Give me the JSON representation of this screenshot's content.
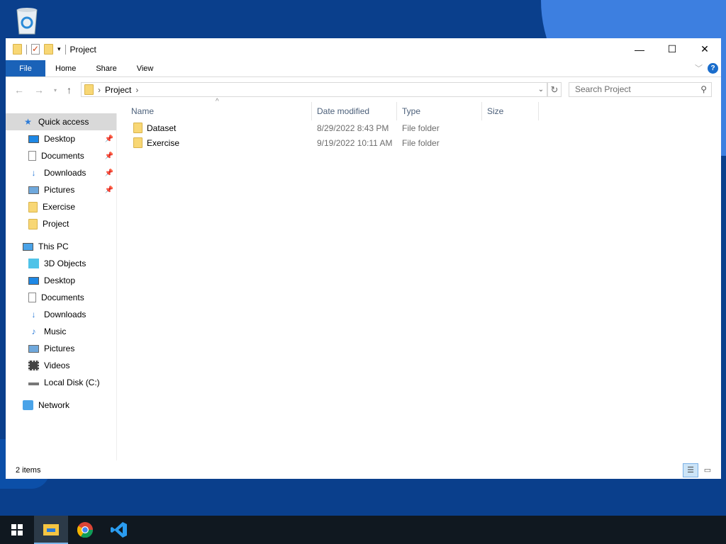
{
  "window": {
    "title": "Project"
  },
  "ribbon": {
    "tabs": [
      "File",
      "Home",
      "Share",
      "View"
    ],
    "help": "?"
  },
  "address": {
    "crumb": "Project",
    "search_placeholder": "Search Project"
  },
  "nav": {
    "quick_access": "Quick access",
    "quick_items": [
      {
        "label": "Desktop",
        "pinned": true
      },
      {
        "label": "Documents",
        "pinned": true
      },
      {
        "label": "Downloads",
        "pinned": true
      },
      {
        "label": "Pictures",
        "pinned": true
      },
      {
        "label": "Exercise"
      },
      {
        "label": "Project"
      }
    ],
    "this_pc": "This PC",
    "pc_items": [
      "3D Objects",
      "Desktop",
      "Documents",
      "Downloads",
      "Music",
      "Pictures",
      "Videos",
      "Local Disk (C:)"
    ],
    "network": "Network"
  },
  "columns": [
    "Name",
    "Date modified",
    "Type",
    "Size"
  ],
  "files": [
    {
      "name": "Dataset",
      "date": "8/29/2022 8:43 PM",
      "type": "File folder",
      "size": ""
    },
    {
      "name": "Exercise",
      "date": "9/19/2022 10:11 AM",
      "type": "File folder",
      "size": ""
    }
  ],
  "status": "2 items"
}
